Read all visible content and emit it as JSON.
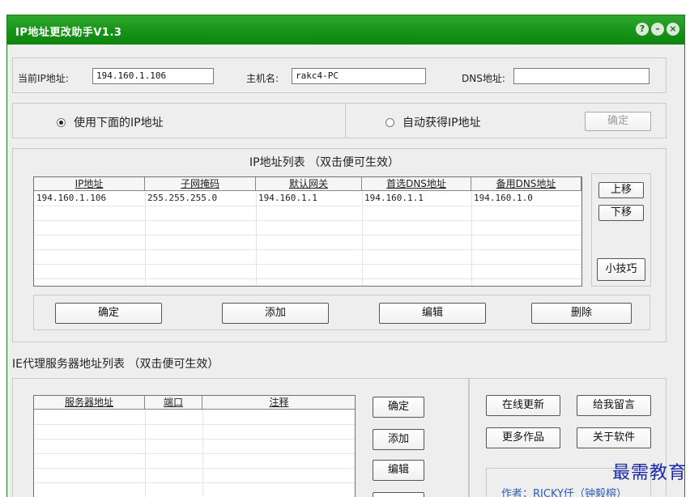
{
  "window": {
    "title": "IP地址更改助手V1.3",
    "controls": {
      "help": "?",
      "minimize": "–",
      "close": "×"
    }
  },
  "host_info": {
    "current_ip_label": "当前IP地址:",
    "current_ip_value": "194.160.1.106",
    "hostname_label": "主机名:",
    "hostname_value": "rakc4-PC",
    "dns_label": "DNS地址:",
    "dns_value": ""
  },
  "mode": {
    "use_below_label": "使用下面的IP地址",
    "use_below_selected": true,
    "auto_label": "自动获得IP地址",
    "auto_selected": false,
    "confirm_label": "确定"
  },
  "ip_list": {
    "title": "IP地址列表 （双击便可生效）",
    "columns": [
      "IP地址",
      "子网掩码",
      "默认网关",
      "首选DNS地址",
      "备用DNS地址"
    ],
    "rows": [
      [
        "194.160.1.106",
        "255.255.255.0",
        "194.160.1.1",
        "194.160.1.1",
        "194.160.1.0"
      ]
    ],
    "side_buttons": {
      "up": "上移",
      "down": "下移",
      "tips": "小技巧"
    },
    "actions": {
      "confirm": "确定",
      "add": "添加",
      "edit": "编辑",
      "delete": "删除"
    }
  },
  "proxy_list": {
    "title": "IE代理服务器地址列表 （双击便可生效）",
    "columns": [
      "服务器地址",
      "端口",
      "注释"
    ],
    "actions": {
      "confirm": "确定",
      "add": "添加",
      "edit": "编辑"
    }
  },
  "extras": {
    "online_update": "在线更新",
    "leave_message": "给我留言",
    "more_works": "更多作品",
    "about": "关于软件",
    "author": "作者：RICKY仟（钟毅榕）"
  },
  "watermark": "最需教育",
  "colors": {
    "titlebar": "#179317",
    "accent_blue": "#2d5db5"
  }
}
